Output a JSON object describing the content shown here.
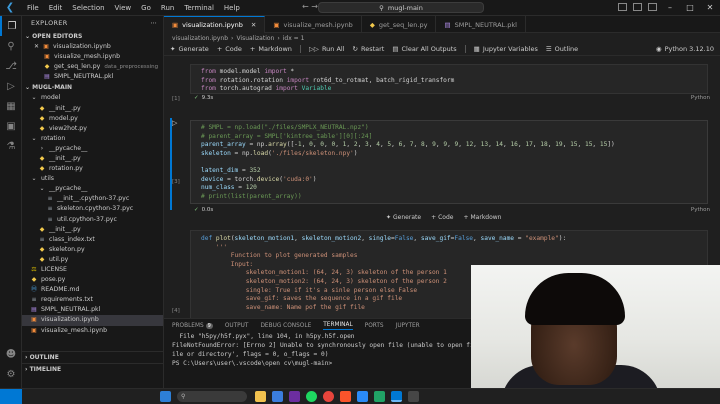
{
  "titlebar": {
    "menu": [
      "File",
      "Edit",
      "Selection",
      "View",
      "Go",
      "Run",
      "Terminal",
      "Help"
    ],
    "command_center": "mugl-main"
  },
  "sidebar": {
    "title": "EXPLORER",
    "open_editors_label": "OPEN EDITORS",
    "open_editors": [
      {
        "name": "visualization.ipynb",
        "type": "nb",
        "close": true
      },
      {
        "name": "visualize_mesh.ipynb",
        "type": "nb"
      },
      {
        "name": "get_seq_len.py",
        "type": "py",
        "sub": "data_preprocessing"
      },
      {
        "name": "SMPL_NEUTRAL.pkl",
        "type": "pkl"
      }
    ],
    "project_label": "MUGL-MAIN",
    "tree": [
      {
        "name": "model",
        "type": "folder",
        "indent": 1,
        "open": true
      },
      {
        "name": "__init__.py",
        "type": "py",
        "indent": 2
      },
      {
        "name": "model.py",
        "type": "py",
        "indent": 2
      },
      {
        "name": "view2hot.py",
        "type": "py",
        "indent": 2
      },
      {
        "name": "rotation",
        "type": "folder",
        "indent": 1,
        "open": true
      },
      {
        "name": "__pycache__",
        "type": "folder",
        "indent": 2,
        "open": false
      },
      {
        "name": "__init__.py",
        "type": "py",
        "indent": 2
      },
      {
        "name": "rotation.py",
        "type": "py",
        "indent": 2
      },
      {
        "name": "utils",
        "type": "folder",
        "indent": 1,
        "open": true
      },
      {
        "name": "__pycache__",
        "type": "folder",
        "indent": 2,
        "open": true
      },
      {
        "name": "__init__.cpython-37.pyc",
        "type": "txt",
        "indent": 3
      },
      {
        "name": "skeleton.cpython-37.pyc",
        "type": "txt",
        "indent": 3
      },
      {
        "name": "util.cpython-37.pyc",
        "type": "txt",
        "indent": 3
      },
      {
        "name": "__init__.py",
        "type": "py",
        "indent": 2
      },
      {
        "name": "class_index.txt",
        "type": "txt",
        "indent": 2
      },
      {
        "name": "skeleton.py",
        "type": "py",
        "indent": 2
      },
      {
        "name": "util.py",
        "type": "py",
        "indent": 2
      },
      {
        "name": "LICENSE",
        "type": "lic",
        "indent": 1
      },
      {
        "name": "pose.py",
        "type": "py",
        "indent": 1
      },
      {
        "name": "README.md",
        "type": "md",
        "indent": 1
      },
      {
        "name": "requirements.txt",
        "type": "txt",
        "indent": 1
      },
      {
        "name": "SMPL_NEUTRAL.pkl",
        "type": "pkl",
        "indent": 1
      },
      {
        "name": "visualization.ipynb",
        "type": "nb",
        "indent": 1,
        "selected": true
      },
      {
        "name": "visualize_mesh.ipynb",
        "type": "nb",
        "indent": 1
      }
    ],
    "outline_label": "OUTLINE",
    "timeline_label": "TIMELINE"
  },
  "tabs": [
    {
      "name": "visualization.ipynb",
      "type": "nb",
      "active": true
    },
    {
      "name": "visualize_mesh.ipynb",
      "type": "nb"
    },
    {
      "name": "get_seq_len.py",
      "type": "py"
    },
    {
      "name": "SMPL_NEUTRAL.pkl",
      "type": "pkl"
    }
  ],
  "breadcrumb": [
    "visualization.ipynb",
    "Visualization",
    "idx = 1"
  ],
  "nb_toolbar": {
    "generate": "Generate",
    "code": "Code",
    "markdown": "Markdown",
    "run_all": "Run All",
    "restart": "Restart",
    "clear_outputs": "Clear All Outputs",
    "variables": "Jupyter Variables",
    "outline": "Outline",
    "kernel": "Python 3.12.10"
  },
  "cells": {
    "cell1": {
      "lines": [
        [
          [
            "kw",
            "from "
          ],
          [
            "plain",
            "model.model "
          ],
          [
            "kw",
            "import "
          ],
          [
            "plain",
            "*"
          ]
        ],
        [
          [
            "kw",
            "from "
          ],
          [
            "plain",
            "rotation.rotation "
          ],
          [
            "kw",
            "import "
          ],
          [
            "plain",
            "rot6d_to_rotmat, batch_rigid_transform"
          ]
        ],
        [
          [
            "kw",
            "from "
          ],
          [
            "plain",
            "torch.autograd "
          ],
          [
            "kw",
            "import "
          ],
          [
            "cls",
            "Variable"
          ]
        ]
      ],
      "count": "[1]",
      "time": "9.3s",
      "lang": "Python"
    },
    "cell2": {
      "lines": [
        [
          [
            "com",
            "# SMPL = np.load(\"./files/SMPLX_NEUTRAL.npz\")"
          ]
        ],
        [
          [
            "com",
            "# parent_array = SMPL['kintree_table'][0][:24]"
          ]
        ],
        [
          [
            "var",
            "parent_array "
          ],
          [
            "plain",
            "= np."
          ],
          [
            "fn",
            "array"
          ],
          [
            "plain",
            "([-"
          ],
          [
            "num",
            "1"
          ],
          [
            "plain",
            ", "
          ],
          [
            "num",
            "0"
          ],
          [
            "plain",
            ", "
          ],
          [
            "num",
            "0"
          ],
          [
            "plain",
            ", "
          ],
          [
            "num",
            "0"
          ],
          [
            "plain",
            ", "
          ],
          [
            "num",
            "1"
          ],
          [
            "plain",
            ", "
          ],
          [
            "num",
            "2"
          ],
          [
            "plain",
            ", "
          ],
          [
            "num",
            "3"
          ],
          [
            "plain",
            ", "
          ],
          [
            "num",
            "4"
          ],
          [
            "plain",
            ", "
          ],
          [
            "num",
            "5"
          ],
          [
            "plain",
            ", "
          ],
          [
            "num",
            "6"
          ],
          [
            "plain",
            ", "
          ],
          [
            "num",
            "7"
          ],
          [
            "plain",
            ", "
          ],
          [
            "num",
            "8"
          ],
          [
            "plain",
            ", "
          ],
          [
            "num",
            "9"
          ],
          [
            "plain",
            ", "
          ],
          [
            "num",
            "9"
          ],
          [
            "plain",
            ", "
          ],
          [
            "num",
            "9"
          ],
          [
            "plain",
            ", "
          ],
          [
            "num",
            "12"
          ],
          [
            "plain",
            ", "
          ],
          [
            "num",
            "13"
          ],
          [
            "plain",
            ", "
          ],
          [
            "num",
            "14"
          ],
          [
            "plain",
            ", "
          ],
          [
            "num",
            "16"
          ],
          [
            "plain",
            ", "
          ],
          [
            "num",
            "17"
          ],
          [
            "plain",
            ", "
          ],
          [
            "num",
            "18"
          ],
          [
            "plain",
            ", "
          ],
          [
            "num",
            "19"
          ],
          [
            "plain",
            ", "
          ],
          [
            "num",
            "15"
          ],
          [
            "plain",
            ", "
          ],
          [
            "num",
            "15"
          ],
          [
            "plain",
            ", "
          ],
          [
            "num",
            "15"
          ],
          [
            "plain",
            "])"
          ]
        ],
        [
          [
            "var",
            "skeleton "
          ],
          [
            "plain",
            "= np."
          ],
          [
            "fn",
            "load"
          ],
          [
            "plain",
            "("
          ],
          [
            "str",
            "'./files/skeleton.npy'"
          ],
          [
            "plain",
            ")"
          ]
        ],
        [
          [
            "plain",
            ""
          ]
        ],
        [
          [
            "var",
            "latent_dim "
          ],
          [
            "plain",
            "= "
          ],
          [
            "num",
            "352"
          ]
        ],
        [
          [
            "var",
            "device "
          ],
          [
            "plain",
            "= torch."
          ],
          [
            "fn",
            "device"
          ],
          [
            "plain",
            "("
          ],
          [
            "str",
            "'cuda:0'"
          ],
          [
            "plain",
            ")"
          ]
        ],
        [
          [
            "var",
            "num_class "
          ],
          [
            "plain",
            "= "
          ],
          [
            "num",
            "120"
          ]
        ],
        [
          [
            "com",
            "# print(list(parent_array))"
          ]
        ]
      ],
      "count": "[3]",
      "time": "0.0s",
      "lang": "Python"
    },
    "insert_bar": {
      "generate": "Generate",
      "code": "Code",
      "markdown": "Markdown"
    },
    "cell3": {
      "lines": [
        [
          [
            "bool",
            "def "
          ],
          [
            "fn",
            "plot"
          ],
          [
            "plain",
            "("
          ],
          [
            "var",
            "skeleton_motion1"
          ],
          [
            "plain",
            ", "
          ],
          [
            "var",
            "skeleton_motion2"
          ],
          [
            "plain",
            ", "
          ],
          [
            "var",
            "single"
          ],
          [
            "plain",
            "="
          ],
          [
            "bool",
            "False"
          ],
          [
            "plain",
            ", "
          ],
          [
            "var",
            "save_gif"
          ],
          [
            "plain",
            "="
          ],
          [
            "bool",
            "False"
          ],
          [
            "plain",
            ", "
          ],
          [
            "var",
            "save_name "
          ],
          [
            "plain",
            "= "
          ],
          [
            "str",
            "\"example\""
          ],
          [
            "plain",
            "):"
          ]
        ],
        [
          [
            "str",
            "    '''"
          ]
        ],
        [
          [
            "str",
            "        Function to plot generated samples"
          ]
        ],
        [
          [
            "str",
            "        Input:"
          ]
        ],
        [
          [
            "str",
            "            skeleton_motion1: (64, 24, 3) skeleton of the person 1"
          ]
        ],
        [
          [
            "str",
            "            skeleton_motion2: (64, 24, 3) skeleton of the person 2"
          ]
        ],
        [
          [
            "str",
            "            single: True if it's a sinle person else False"
          ]
        ],
        [
          [
            "str",
            "            save_gif: saves the sequence in a gif file"
          ]
        ],
        [
          [
            "str",
            "            save_name: Name pof the gif file"
          ]
        ]
      ],
      "count": "[4]"
    }
  },
  "panel": {
    "tabs": [
      {
        "label": "PROBLEMS",
        "badge": "9"
      },
      {
        "label": "OUTPUT"
      },
      {
        "label": "DEBUG CONSOLE"
      },
      {
        "label": "TERMINAL",
        "active": true
      },
      {
        "label": "PORTS"
      },
      {
        "label": "JUPYTER"
      }
    ],
    "terminal": [
      "  File \"h5py/h5f.pyx\", line 104, in h5py.h5f.open",
      "FileNotFoundError: [Errno 2] Unable to synchronously open file (unable to open file: nam",
      "ile or directory', flags = 0, o_flags = 0)",
      "PS C:\\Users\\user\\.vscode\\open cv\\mugl-main> "
    ]
  },
  "colors": {
    "accent": "#0078d4",
    "bg": "#1f1f1f",
    "sidebar_bg": "#181818"
  }
}
